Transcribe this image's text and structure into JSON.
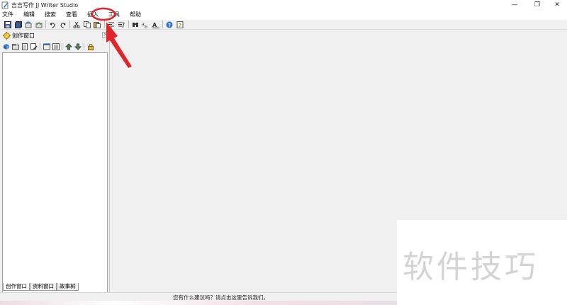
{
  "window": {
    "title": "吉吉写作 JJ Writer Studio",
    "controls": {
      "minimize": "—",
      "maximize": "❐",
      "close": "✕"
    }
  },
  "menubar": {
    "items": [
      "文件",
      "编辑",
      "搜索",
      "查看",
      "插入",
      "工具",
      "帮助"
    ],
    "highlighted_item": "工具"
  },
  "toolbar": {
    "buttons": [
      "save-icon",
      "save-all-icon",
      "undo-history-icon",
      "redo-history-icon",
      "undo-icon",
      "redo-icon",
      "cut-icon",
      "copy-icon",
      "paste-icon",
      "align-icon",
      "format-icon",
      "find-icon",
      "replace-icon",
      "font-icon",
      "help-icon",
      "about-icon"
    ]
  },
  "left_panel": {
    "title": "创作窗口",
    "close_glyph": "✕",
    "toolbar_icons": [
      "new-book-icon",
      "new-folder-icon",
      "new-page-icon",
      "edit-icon",
      "properties-icon",
      "list-icon",
      "move-up-icon",
      "move-down-icon",
      "lock-icon"
    ],
    "tabs": [
      "创作窗口",
      "资料窗口",
      "故事树"
    ],
    "active_tab": 0
  },
  "statusbar": {
    "text": "您有什么建议吗？请点击这里告诉我们。"
  },
  "watermark": {
    "text": "软件技巧"
  },
  "colors": {
    "annotation_red": "#e0262a",
    "window_bg": "#f0f0f0",
    "titlebar_bg": "#ffffff",
    "watermark_text": "#d4d4d4"
  }
}
